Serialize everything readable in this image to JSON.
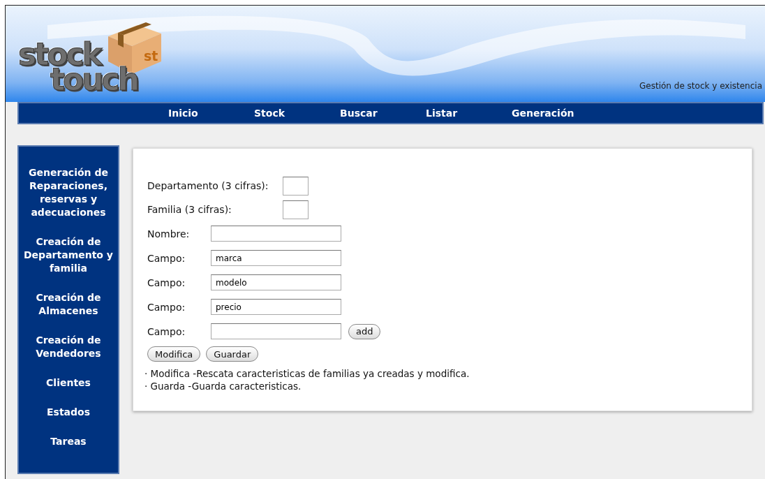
{
  "header": {
    "logo": {
      "line_1": "stock",
      "line_2": "touch",
      "badge": "st"
    },
    "tagline": "Gestión de stock y existencia"
  },
  "nav": [
    "Inicio",
    "Stock",
    "Buscar",
    "Listar",
    "Generación"
  ],
  "sidebar": [
    "Generación de Reparaciones, reservas y adecuaciones",
    "Creación de Departamento y familia",
    "Creación de Almacenes",
    "Creación de Vendedores",
    "Clientes",
    "Estados",
    "Tareas"
  ],
  "form": {
    "fields": [
      {
        "kind": "short",
        "label": "Departamento (3 cifras):"
      },
      {
        "kind": "short",
        "label": "Familia (3 cifras):"
      },
      {
        "kind": "long",
        "label": "Nombre:"
      },
      {
        "kind": "long",
        "label": "Campo:",
        "value": "marca"
      },
      {
        "kind": "long",
        "label": "Campo:",
        "value": "modelo"
      },
      {
        "kind": "long",
        "label": "Campo:",
        "value": "precio"
      },
      {
        "kind": "long",
        "label": "Campo:",
        "button": "add"
      }
    ],
    "buttons": [
      "Modifica",
      "Guardar"
    ],
    "notes": [
      "· Modifica -Rescata caracteristicas de familias ya creadas y modifica.",
      "· Guarda -Guarda caracteristicas."
    ]
  }
}
